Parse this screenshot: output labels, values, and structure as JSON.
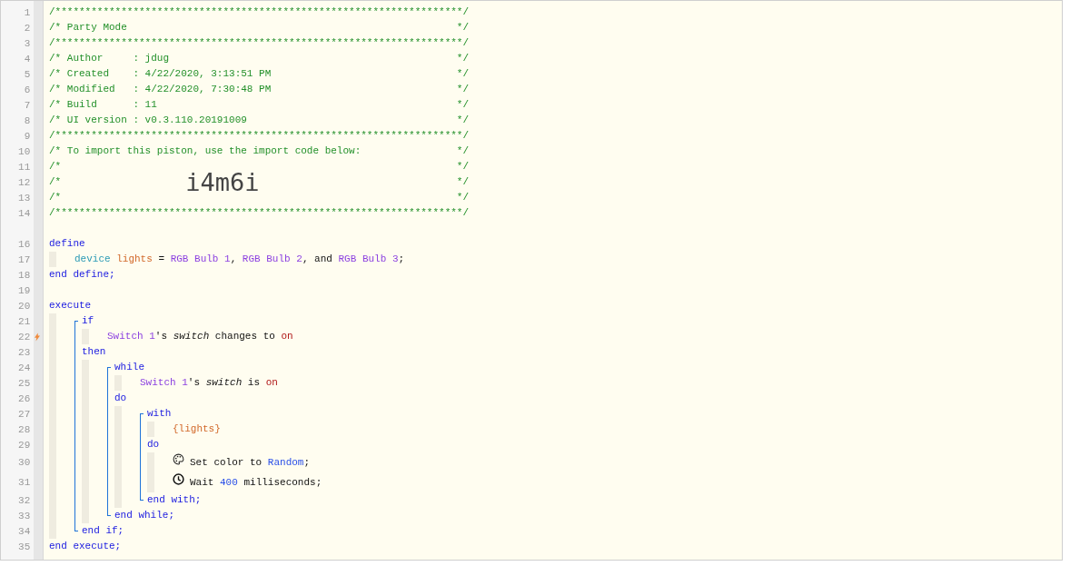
{
  "lines": [
    {
      "number": "1",
      "kind": "comment",
      "trigger": false,
      "tokens": [
        {
          "kind": "comment",
          "text": "/********************************************************************/"
        }
      ]
    },
    {
      "number": "2",
      "kind": "comment",
      "trigger": false,
      "tokens": [
        {
          "kind": "comment",
          "text": "/* Party Mode"
        },
        {
          "kind": "comment",
          "text": "*/"
        }
      ]
    },
    {
      "number": "3",
      "kind": "comment",
      "trigger": false,
      "tokens": [
        {
          "kind": "comment",
          "text": "/********************************************************************/"
        }
      ]
    },
    {
      "number": "4",
      "kind": "comment",
      "trigger": false,
      "tokens": [
        {
          "kind": "comment",
          "text": "/* Author     : jdug"
        },
        {
          "kind": "comment",
          "text": "*/"
        }
      ]
    },
    {
      "number": "5",
      "kind": "comment",
      "trigger": false,
      "tokens": [
        {
          "kind": "comment",
          "text": "/* Created    : 4/22/2020, 3:13:51 PM"
        },
        {
          "kind": "comment",
          "text": "*/"
        }
      ]
    },
    {
      "number": "6",
      "kind": "comment",
      "trigger": false,
      "tokens": [
        {
          "kind": "comment",
          "text": "/* Modified   : 4/22/2020, 7:30:48 PM"
        },
        {
          "kind": "comment",
          "text": "*/"
        }
      ]
    },
    {
      "number": "7",
      "kind": "comment",
      "trigger": false,
      "tokens": [
        {
          "kind": "comment",
          "text": "/* Build      : 11"
        },
        {
          "kind": "comment",
          "text": "*/"
        }
      ]
    },
    {
      "number": "8",
      "kind": "comment",
      "trigger": false,
      "tokens": [
        {
          "kind": "comment",
          "text": "/* UI version : v0.3.110.20191009"
        },
        {
          "kind": "comment",
          "text": "*/"
        }
      ]
    },
    {
      "number": "9",
      "kind": "comment",
      "trigger": false,
      "tokens": [
        {
          "kind": "comment",
          "text": "/********************************************************************/"
        }
      ]
    },
    {
      "number": "10",
      "kind": "comment",
      "trigger": false,
      "tokens": [
        {
          "kind": "comment",
          "text": "/* To import this piston, use the import code below:"
        },
        {
          "kind": "comment",
          "text": "*/"
        }
      ]
    },
    {
      "number": "11",
      "kind": "comment",
      "trigger": false,
      "tokens": [
        {
          "kind": "comment",
          "text": "/*"
        },
        {
          "kind": "comment",
          "text": "*/"
        }
      ]
    },
    {
      "number": "12",
      "kind": "comment",
      "trigger": false,
      "tokens": [
        {
          "kind": "comment",
          "text": "/*"
        },
        {
          "kind": "import-code",
          "text": "i4m6i"
        },
        {
          "kind": "comment",
          "text": "*/"
        }
      ]
    },
    {
      "number": "13",
      "kind": "comment",
      "trigger": false,
      "tokens": [
        {
          "kind": "comment",
          "text": "/*"
        },
        {
          "kind": "comment",
          "text": "*/"
        }
      ]
    },
    {
      "number": "14",
      "kind": "comment",
      "trigger": false,
      "tokens": [
        {
          "kind": "comment",
          "text": "/********************************************************************/"
        }
      ]
    },
    {
      "kind": "blank"
    },
    {
      "number": "16",
      "kind": "statement",
      "trigger": false,
      "tokens": [
        {
          "kind": "keyword",
          "text": "define"
        }
      ],
      "children": [
        {
          "number": "17",
          "kind": "statement",
          "trigger": false,
          "tokens": [
            {
              "kind": "type",
              "text": "device "
            },
            {
              "kind": "variable",
              "text": "lights"
            },
            {
              "kind": "plain",
              "text": " = "
            },
            {
              "kind": "device",
              "text": "RGB Bulb 1"
            },
            {
              "kind": "plain",
              "text": ", "
            },
            {
              "kind": "device",
              "text": "RGB Bulb 2"
            },
            {
              "kind": "plain",
              "text": ", and "
            },
            {
              "kind": "device",
              "text": "RGB Bulb 3"
            },
            {
              "kind": "plain",
              "text": ";"
            }
          ]
        }
      ]
    },
    {
      "number": "18",
      "kind": "statement",
      "trigger": false,
      "tokens": [
        {
          "kind": "keyword",
          "text": "end define;"
        }
      ]
    },
    {
      "number": "19",
      "kind": "blank",
      "trigger": false
    },
    {
      "number": "20",
      "kind": "statement",
      "trigger": false,
      "tokens": [
        {
          "kind": "keyword",
          "text": "execute"
        }
      ],
      "children": [
        {
          "kind": "block",
          "children": [
            {
              "number": "21",
              "kind": "statement",
              "trigger": false,
              "tokens": [
                {
                  "kind": "keyword",
                  "text": "if"
                }
              ],
              "children": [
                {
                  "number": "22",
                  "kind": "statement",
                  "trigger": true,
                  "tokens": [
                    {
                      "kind": "device",
                      "text": "Switch 1"
                    },
                    {
                      "kind": "plain",
                      "text": "'s "
                    },
                    {
                      "kind": "attribute",
                      "text": "switch"
                    },
                    {
                      "kind": "plain",
                      "text": " changes to "
                    },
                    {
                      "kind": "value",
                      "text": "on"
                    }
                  ]
                }
              ]
            },
            {
              "number": "23",
              "kind": "statement",
              "trigger": false,
              "tokens": [
                {
                  "kind": "keyword",
                  "text": "then"
                }
              ],
              "children": [
                {
                  "kind": "block",
                  "children": [
                    {
                      "number": "24",
                      "kind": "statement",
                      "trigger": false,
                      "tokens": [
                        {
                          "kind": "keyword",
                          "text": "while"
                        }
                      ],
                      "children": [
                        {
                          "number": "25",
                          "kind": "statement",
                          "trigger": false,
                          "tokens": [
                            {
                              "kind": "device",
                              "text": "Switch 1"
                            },
                            {
                              "kind": "plain",
                              "text": "'s "
                            },
                            {
                              "kind": "attribute",
                              "text": "switch"
                            },
                            {
                              "kind": "plain",
                              "text": " is "
                            },
                            {
                              "kind": "value",
                              "text": "on"
                            }
                          ]
                        }
                      ]
                    },
                    {
                      "number": "26",
                      "kind": "statement",
                      "trigger": false,
                      "tokens": [
                        {
                          "kind": "keyword",
                          "text": "do"
                        }
                      ],
                      "children": [
                        {
                          "kind": "block",
                          "children": [
                            {
                              "number": "27",
                              "kind": "statement",
                              "trigger": false,
                              "tokens": [
                                {
                                  "kind": "keyword",
                                  "text": "with"
                                }
                              ],
                              "children": [
                                {
                                  "number": "28",
                                  "kind": "statement",
                                  "trigger": false,
                                  "tokens": [
                                    {
                                      "kind": "variable",
                                      "text": "{lights}"
                                    }
                                  ]
                                }
                              ]
                            },
                            {
                              "number": "29",
                              "kind": "statement",
                              "trigger": false,
                              "tokens": [
                                {
                                  "kind": "keyword",
                                  "text": "do"
                                }
                              ],
                              "children": [
                                {
                                  "number": "30",
                                  "kind": "set-color",
                                  "trigger": false,
                                  "tokens": [
                                    {
                                      "kind": "plain",
                                      "text": "Set color to "
                                    },
                                    {
                                      "kind": "number",
                                      "text": "Random"
                                    },
                                    {
                                      "kind": "plain",
                                      "text": ";"
                                    }
                                  ]
                                },
                                {
                                  "number": "31",
                                  "kind": "wait",
                                  "trigger": false,
                                  "tokens": [
                                    {
                                      "kind": "plain",
                                      "text": "Wait "
                                    },
                                    {
                                      "kind": "number",
                                      "text": "400"
                                    },
                                    {
                                      "kind": "plain",
                                      "text": " milliseconds;"
                                    }
                                  ]
                                }
                              ]
                            },
                            {
                              "number": "32",
                              "kind": "statement",
                              "trigger": false,
                              "tokens": [
                                {
                                  "kind": "keyword",
                                  "text": "end with;"
                                }
                              ]
                            }
                          ]
                        }
                      ]
                    },
                    {
                      "number": "33",
                      "kind": "statement",
                      "trigger": false,
                      "tokens": [
                        {
                          "kind": "keyword",
                          "text": "end while;"
                        }
                      ]
                    }
                  ]
                }
              ]
            },
            {
              "number": "34",
              "kind": "statement",
              "trigger": false,
              "tokens": [
                {
                  "kind": "keyword",
                  "text": "end if;"
                }
              ]
            }
          ]
        }
      ]
    },
    {
      "number": "35",
      "kind": "statement",
      "trigger": false,
      "tokens": [
        {
          "kind": "keyword",
          "text": "end execute;"
        }
      ]
    }
  ]
}
